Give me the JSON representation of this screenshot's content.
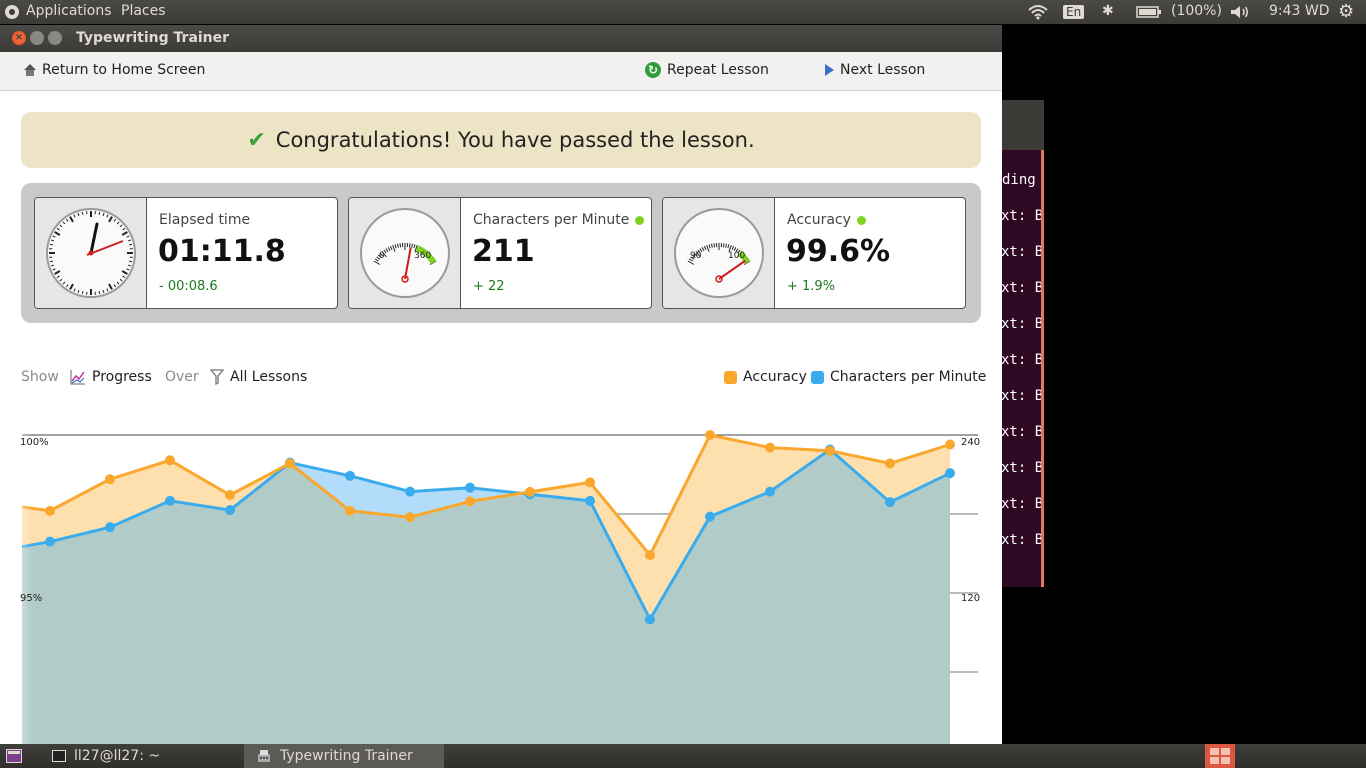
{
  "top_panel": {
    "applications": "Applications",
    "places": "Places",
    "keyboard": "En",
    "battery": "(100%)",
    "clock": "9:43 WD",
    "icons": [
      "ubuntu-logo-icon",
      "wifi-icon",
      "bluetooth-icon",
      "battery-icon",
      "volume-icon",
      "gear-icon"
    ]
  },
  "terminal": {
    "lines": [
      "ding",
      "xt: B",
      "xt: B",
      "xt: B",
      "xt: B",
      "xt: B",
      "xt: B",
      "xt: B",
      "xt: B",
      "xt: B",
      "xt: B"
    ]
  },
  "window": {
    "title": "Typewriting Trainer",
    "close_glyph": "×",
    "toolbar": {
      "home": "Return to Home Screen",
      "repeat": "Repeat Lesson",
      "next": "Next Lesson"
    },
    "banner": "Congratulations! You have passed the lesson.",
    "stats": {
      "elapsed": {
        "label": "Elapsed time",
        "value": "01:11.8",
        "delta": "- 00:08.6"
      },
      "cpm": {
        "label": "Characters per Minute",
        "value": "211",
        "delta": "+ 22",
        "dial_min": "0",
        "dial_max": "360",
        "needle_value": 211
      },
      "accuracy": {
        "label": "Accuracy",
        "value": "99.6%",
        "delta": "+ 1.9%",
        "dial_min": "90",
        "dial_max": "100",
        "needle_value": 99.6
      }
    },
    "chart_controls": {
      "show": "Show",
      "progress": "Progress",
      "over": "Over",
      "all_lessons": "All Lessons",
      "legend_accuracy": "Accuracy",
      "legend_cpm": "Characters per Minute"
    }
  },
  "colors": {
    "accuracy": "#f9a82d",
    "cpm": "#3aaced",
    "dot": "#7ed321"
  },
  "chart_data": {
    "type": "area",
    "left_axis": {
      "ticks": [
        "100%",
        "95%"
      ],
      "range": [
        90,
        100
      ]
    },
    "right_axis": {
      "ticks": [
        "240",
        "120"
      ],
      "range": [
        0,
        240
      ]
    },
    "series": [
      {
        "name": "Accuracy",
        "axis": "left",
        "values": [
          97.6,
          98.6,
          99.2,
          98.1,
          99.1,
          97.6,
          97.4,
          97.9,
          98.2,
          98.5,
          96.2,
          100.0,
          99.6,
          99.5,
          99.1,
          99.7
        ]
      },
      {
        "name": "Characters per Minute",
        "axis": "right",
        "values": [
          159,
          170,
          190,
          183,
          219,
          209,
          197,
          200,
          195,
          190,
          100,
          178,
          197,
          229,
          189,
          211
        ]
      }
    ]
  },
  "bottom_panel": {
    "terminal_task": "ll27@ll27: ~",
    "trainer_task": "Typewriting Trainer"
  }
}
